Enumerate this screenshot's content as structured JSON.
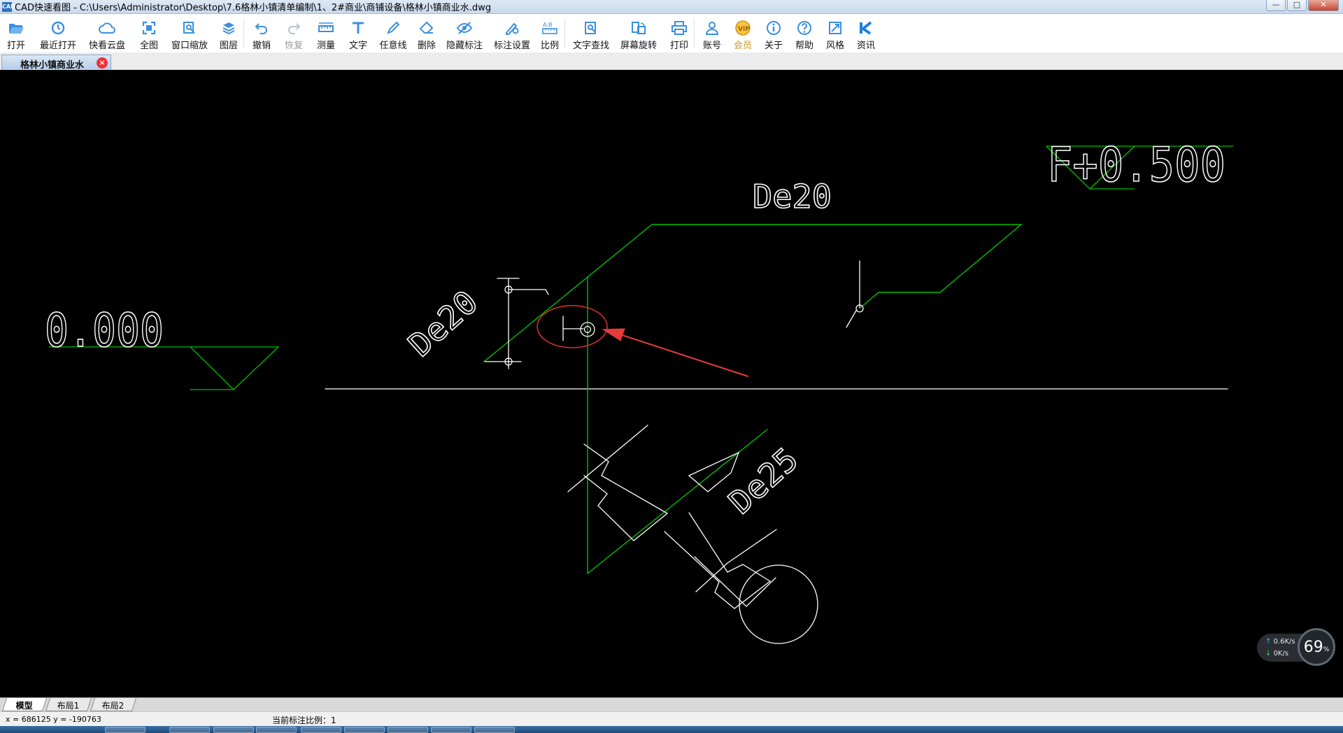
{
  "window": {
    "title": "CAD快速看图 - C:\\Users\\Administrator\\Desktop\\7.6格林小镇清单编制\\1、2#商业\\商铺设备\\格林小镇商业水.dwg",
    "app_icon_text": "CAD",
    "minimize": "—",
    "maximize": "□",
    "close": "✕"
  },
  "toolbar": {
    "items": [
      {
        "label": "打开",
        "icon": "folder-open-icon"
      },
      {
        "label": "最近打开",
        "icon": "recent-clock-icon"
      },
      {
        "label": "快看云盘",
        "icon": "cloud-icon"
      },
      {
        "label": "全图",
        "icon": "fit-all-icon"
      },
      {
        "label": "窗口缩放",
        "icon": "window-zoom-icon"
      },
      {
        "label": "图层",
        "icon": "layers-icon"
      },
      {
        "label": "撤销",
        "icon": "undo-icon"
      },
      {
        "label": "恢复",
        "icon": "redo-icon"
      },
      {
        "label": "测量",
        "icon": "ruler-icon"
      },
      {
        "label": "文字",
        "icon": "text-icon"
      },
      {
        "label": "任意线",
        "icon": "pen-icon"
      },
      {
        "label": "删除",
        "icon": "eraser-icon"
      },
      {
        "label": "隐藏标注",
        "icon": "hide-eye-icon"
      },
      {
        "label": "标注设置",
        "icon": "annotation-settings-icon"
      },
      {
        "label": "比例",
        "icon": "scale-icon"
      },
      {
        "label": "文字查找",
        "icon": "text-search-icon"
      },
      {
        "label": "屏幕旋转",
        "icon": "rotate-screen-icon"
      },
      {
        "label": "打印",
        "icon": "printer-icon"
      },
      {
        "label": "账号",
        "icon": "user-icon"
      },
      {
        "label": "会员",
        "icon": "vip-icon"
      },
      {
        "label": "关于",
        "icon": "info-icon"
      },
      {
        "label": "帮助",
        "icon": "help-icon"
      },
      {
        "label": "风格",
        "icon": "style-icon"
      },
      {
        "label": "资讯",
        "icon": "news-k-icon"
      }
    ]
  },
  "doc_tab": {
    "label": "格林小镇商业水",
    "close": "×"
  },
  "drawing": {
    "texts": {
      "elev_left": "0.000",
      "elev_right": "F+0.500",
      "pipe_top": "De20",
      "pipe_left": "De20",
      "pipe_bottom": "De25"
    },
    "colors": {
      "pipe_green": "#00c000",
      "line_white": "#ffffff",
      "highlight_red": "#e03030",
      "arrow_red": "#e83a3a"
    }
  },
  "net_widget": {
    "upload": "0.6K/s",
    "download": "0K/s",
    "percent": "69",
    "percent_unit": "%"
  },
  "layout_tabs": [
    {
      "label": "模型",
      "active": true
    },
    {
      "label": "布局1",
      "active": false
    },
    {
      "label": "布局2",
      "active": false
    }
  ],
  "status": {
    "coords": "x = 686125  y = -190763",
    "scale": "当前标注比例：1"
  }
}
